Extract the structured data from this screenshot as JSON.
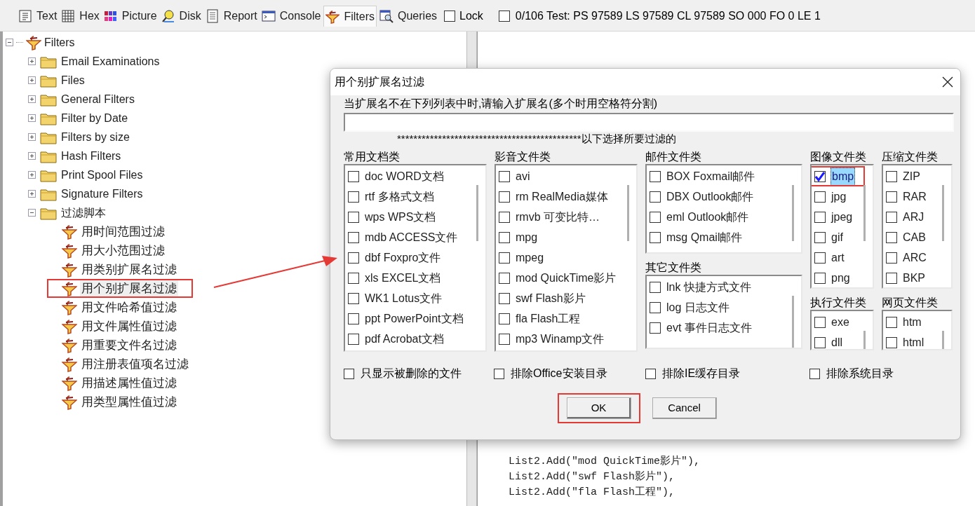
{
  "toolbar": {
    "tabs": [
      {
        "label": "Text",
        "selected": false
      },
      {
        "label": "Hex",
        "selected": false
      },
      {
        "label": "Picture",
        "selected": false
      },
      {
        "label": "Disk",
        "selected": false
      },
      {
        "label": "Report",
        "selected": false
      },
      {
        "label": "Console",
        "selected": false
      },
      {
        "label": "Filters",
        "selected": true
      },
      {
        "label": "Queries",
        "selected": false
      }
    ],
    "lock": {
      "label": "Lock",
      "checked": false
    },
    "status": "0/106 Test: PS 97589 LS 97589 CL 97589 SO 000 FO 0 LE 1"
  },
  "tree": {
    "label": "Filters",
    "expanded": true,
    "children": [
      {
        "label": "Email Examinations",
        "kind": "folder",
        "expanded": false
      },
      {
        "label": "Files",
        "kind": "folder",
        "expanded": false
      },
      {
        "label": "General Filters",
        "kind": "folder",
        "expanded": false
      },
      {
        "label": "Filter by Date",
        "kind": "folder",
        "expanded": false
      },
      {
        "label": "Filters by size",
        "kind": "folder",
        "expanded": false
      },
      {
        "label": "Hash Filters",
        "kind": "folder",
        "expanded": false
      },
      {
        "label": "Print Spool Files",
        "kind": "folder",
        "expanded": false
      },
      {
        "label": "Signature Filters",
        "kind": "folder",
        "expanded": false
      },
      {
        "label": "过滤脚本",
        "kind": "folder",
        "expanded": true,
        "children": [
          {
            "label": "用时间范围过滤",
            "kind": "filter",
            "selected": false,
            "marked": false
          },
          {
            "label": "用大小范围过滤",
            "kind": "filter",
            "selected": false,
            "marked": false
          },
          {
            "label": "用类别扩展名过滤",
            "kind": "filter",
            "selected": false,
            "marked": false
          },
          {
            "label": "用个别扩展名过滤",
            "kind": "filter",
            "selected": true,
            "marked": true
          },
          {
            "label": "用文件哈希值过滤",
            "kind": "filter",
            "selected": false,
            "marked": false
          },
          {
            "label": "用文件属性值过滤",
            "kind": "filter",
            "selected": false,
            "marked": false
          },
          {
            "label": "用重要文件名过滤",
            "kind": "filter",
            "selected": false,
            "marked": false
          },
          {
            "label": "用注册表值项名过滤",
            "kind": "filter",
            "selected": false,
            "marked": false
          },
          {
            "label": "用描述属性值过滤",
            "kind": "filter",
            "selected": false,
            "marked": false
          },
          {
            "label": "用类型属性值过滤",
            "kind": "filter",
            "selected": false,
            "marked": false
          }
        ]
      }
    ]
  },
  "code_lines": [
    "List2.Add(\"mod QuickTime影片\"),",
    "List2.Add(\"swf Flash影片\"),",
    "List2.Add(\"fla Flash工程\"),"
  ],
  "dialog": {
    "title": "用个别扩展名过滤",
    "prompt": "当扩展名不在下列列表中时,请输入扩展名(多个时用空格符分割)",
    "divider_text": "*********************************************以下选择所要过滤的",
    "groups": [
      {
        "title": "常用文档类",
        "items": [
          {
            "label": "doc WORD文档",
            "checked": false,
            "selected": false,
            "marked": false
          },
          {
            "label": "rtf 多格式文档",
            "checked": false,
            "selected": false,
            "marked": false
          },
          {
            "label": "wps WPS文档",
            "checked": false,
            "selected": false,
            "marked": false
          },
          {
            "label": "mdb ACCESS文件",
            "checked": false,
            "selected": false,
            "marked": false
          },
          {
            "label": "dbf Foxpro文件",
            "checked": false,
            "selected": false,
            "marked": false
          },
          {
            "label": "xls EXCEL文档",
            "checked": false,
            "selected": false,
            "marked": false
          },
          {
            "label": "WK1 Lotus文件",
            "checked": false,
            "selected": false,
            "marked": false
          },
          {
            "label": "ppt PowerPoint文档",
            "checked": false,
            "selected": false,
            "marked": false
          },
          {
            "label": "pdf Acrobat文档",
            "checked": false,
            "selected": false,
            "marked": false
          }
        ]
      },
      {
        "title": "影音文件类",
        "items": [
          {
            "label": "avi",
            "checked": false,
            "selected": false,
            "marked": false
          },
          {
            "label": "rm RealMedia媒体",
            "checked": false,
            "selected": false,
            "marked": false
          },
          {
            "label": "rmvb 可变比特…",
            "checked": false,
            "selected": false,
            "marked": false
          },
          {
            "label": "mpg",
            "checked": false,
            "selected": false,
            "marked": false
          },
          {
            "label": "mpeg",
            "checked": false,
            "selected": false,
            "marked": false
          },
          {
            "label": "mod QuickTime影片",
            "checked": false,
            "selected": false,
            "marked": false
          },
          {
            "label": "swf Flash影片",
            "checked": false,
            "selected": false,
            "marked": false
          },
          {
            "label": "fla Flash工程",
            "checked": false,
            "selected": false,
            "marked": false
          },
          {
            "label": "mp3 Winamp文件",
            "checked": false,
            "selected": false,
            "marked": false
          }
        ]
      },
      {
        "title": "邮件文件类",
        "items": [
          {
            "label": "BOX Foxmail邮件",
            "checked": false,
            "selected": false,
            "marked": false
          },
          {
            "label": "DBX Outlook邮件",
            "checked": false,
            "selected": false,
            "marked": false
          },
          {
            "label": "eml Outlook邮件",
            "checked": false,
            "selected": false,
            "marked": false
          },
          {
            "label": "msg Qmail邮件",
            "checked": false,
            "selected": false,
            "marked": false
          }
        ]
      },
      {
        "title": "图像文件类",
        "items": [
          {
            "label": "bmp",
            "checked": true,
            "selected": true,
            "marked": true
          },
          {
            "label": "jpg",
            "checked": false,
            "selected": false,
            "marked": false
          },
          {
            "label": "jpeg",
            "checked": false,
            "selected": false,
            "marked": false
          },
          {
            "label": "gif",
            "checked": false,
            "selected": false,
            "marked": false
          },
          {
            "label": "art",
            "checked": false,
            "selected": false,
            "marked": false
          },
          {
            "label": "png",
            "checked": false,
            "selected": false,
            "marked": false
          }
        ]
      },
      {
        "title": "压缩文件类",
        "items": [
          {
            "label": "ZIP",
            "checked": false,
            "selected": false,
            "marked": false
          },
          {
            "label": "RAR",
            "checked": false,
            "selected": false,
            "marked": false
          },
          {
            "label": "ARJ",
            "checked": false,
            "selected": false,
            "marked": false
          },
          {
            "label": "CAB",
            "checked": false,
            "selected": false,
            "marked": false
          },
          {
            "label": "ARC",
            "checked": false,
            "selected": false,
            "marked": false
          },
          {
            "label": "BKP",
            "checked": false,
            "selected": false,
            "marked": false
          }
        ]
      },
      {
        "title": "其它文件类",
        "items": [
          {
            "label": "lnk 快捷方式文件",
            "checked": false,
            "selected": false,
            "marked": false
          },
          {
            "label": "log 日志文件",
            "checked": false,
            "selected": false,
            "marked": false
          },
          {
            "label": "evt 事件日志文件",
            "checked": false,
            "selected": false,
            "marked": false
          }
        ]
      },
      {
        "title": "执行文件类",
        "items": [
          {
            "label": "exe",
            "checked": false,
            "selected": false,
            "marked": false
          },
          {
            "label": "dll",
            "checked": false,
            "selected": false,
            "marked": false
          }
        ]
      },
      {
        "title": "网页文件类",
        "items": [
          {
            "label": "htm",
            "checked": false,
            "selected": false,
            "marked": false
          },
          {
            "label": "html",
            "checked": false,
            "selected": false,
            "marked": false
          }
        ]
      }
    ],
    "options": [
      {
        "label": "只显示被删除的文件",
        "checked": false
      },
      {
        "label": "排除Office安装目录",
        "checked": false
      },
      {
        "label": "排除IE缓存目录",
        "checked": false
      },
      {
        "label": "排除系统目录",
        "checked": false
      }
    ],
    "buttons": [
      {
        "label": "OK",
        "kind": "default",
        "marked": true
      },
      {
        "label": "Cancel",
        "kind": "normal",
        "marked": false
      }
    ]
  }
}
